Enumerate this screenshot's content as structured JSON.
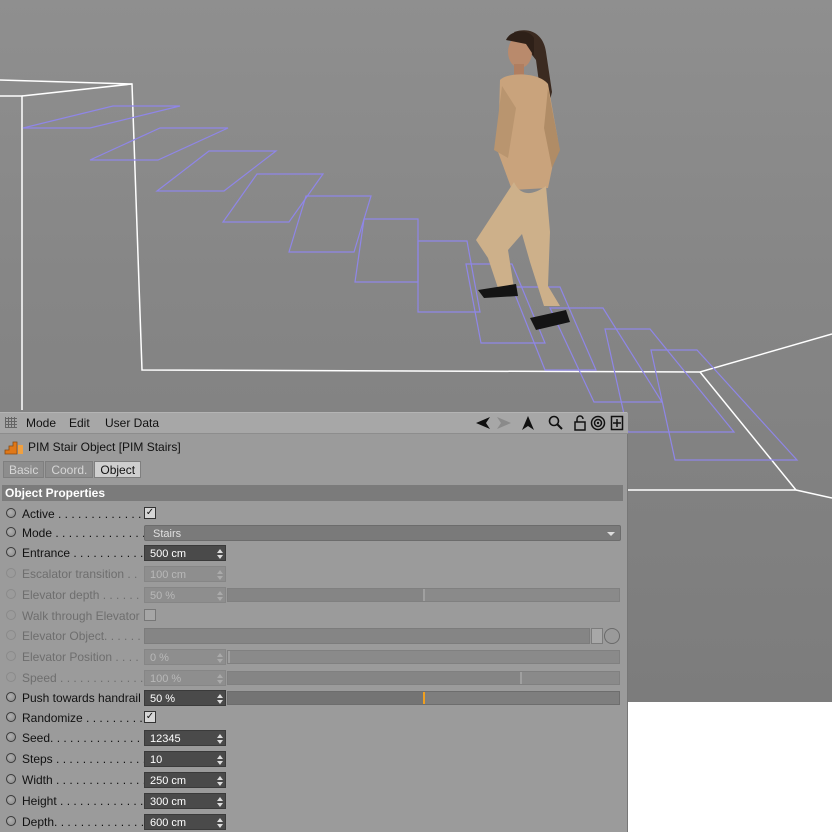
{
  "menu": {
    "mode": "Mode",
    "edit": "Edit",
    "user_data": "User Data"
  },
  "toolbar_icons": [
    "back-arrow-icon",
    "forward-arrow-icon",
    "cursor-icon",
    "search-icon",
    "unlock-icon",
    "target-icon",
    "new-panel-icon"
  ],
  "object": {
    "title": "PIM Stair Object [PIM Stairs]",
    "icon": "stair-object-icon"
  },
  "tabs": [
    {
      "label": "Basic",
      "active": false
    },
    {
      "label": "Coord.",
      "active": false
    },
    {
      "label": "Object",
      "active": true
    }
  ],
  "section_title": "Object Properties",
  "properties": {
    "active": {
      "label": "Active . . . . . . . . . . . . .",
      "checked": true
    },
    "mode": {
      "label": "Mode . . . . . . . . . . . . . .",
      "value": "Stairs"
    },
    "entrance": {
      "label": "Entrance . . . . . . . . . . .",
      "value": "500 cm"
    },
    "escalator_transition": {
      "label": "Escalator transition . .",
      "value": "100 cm"
    },
    "elevator_depth": {
      "label": "Elevator depth . . . . . .",
      "value": "50 %",
      "level": 0.5
    },
    "walk_through_elevator": {
      "label": "Walk through Elevator",
      "checked": false
    },
    "elevator_object": {
      "label": "Elevator Object. . . . . ."
    },
    "elevator_position": {
      "label": "Elevator Position . . . .",
      "value": "0 %",
      "level": 0
    },
    "speed": {
      "label": "Speed . . . . . . . . . . . . .",
      "value": "100 %",
      "level": 0.75
    },
    "push_towards_handrail": {
      "label": "Push towards handrail",
      "value": "50 %",
      "level": 0.5
    },
    "randomize": {
      "label": "Randomize . . . . . . . . .",
      "checked": true
    },
    "seed": {
      "label": "Seed. . . . . . . . . . . . . . .",
      "value": "12345"
    },
    "steps": {
      "label": "Steps . . . . . . . . . . . . . .",
      "value": "10"
    },
    "width": {
      "label": "Width . . . . . . . . . . . . . .",
      "value": "250 cm"
    },
    "height": {
      "label": "Height . . . . . . . . . . . . .",
      "value": "300 cm"
    },
    "depth": {
      "label": "Depth. . . . . . . . . . . . . .",
      "value": "600 cm"
    }
  },
  "colors": {
    "viewport_bg": "#868686",
    "step_outline": "#8f86e8",
    "guide_lines": "#ffffff",
    "slider_accent": "#f0a020"
  }
}
